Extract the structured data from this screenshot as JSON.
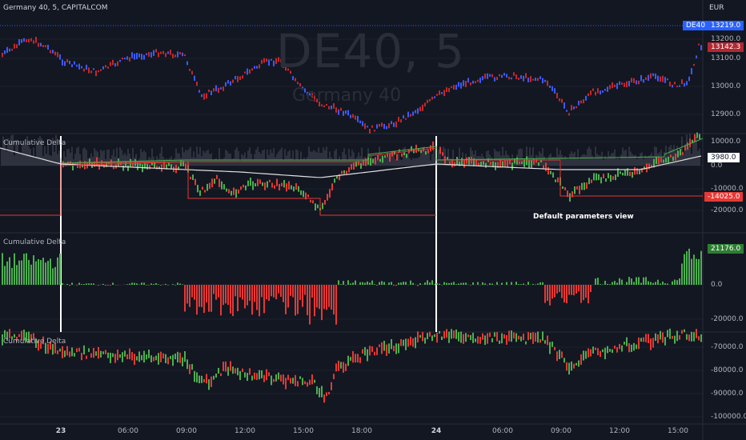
{
  "header": {
    "symbol_title": "Germany 40, 5, CAPITALCOM",
    "currency": "EUR"
  },
  "watermark": {
    "main": "DE40, 5",
    "sub": "Germany 40"
  },
  "price_pane": {
    "ticks": [
      "13200.0",
      "13100.0",
      "13000.0",
      "12900.0"
    ],
    "badge_symbol": "DE40",
    "badge_last": "13219.0",
    "badge_current": "13142.3"
  },
  "delta_pane": {
    "title": "Cumulative Delta",
    "ticks": [
      "10000.0",
      "0.0",
      "-10000.0",
      "-20000.0"
    ],
    "badge_white": "3980.0",
    "badge_red": "-14025.0",
    "annotation": "Default parameters view"
  },
  "histogram_pane": {
    "title": "Cumulative Delta",
    "ticks": [
      "0.0",
      "-20000.0"
    ],
    "badge_green": "21176.0"
  },
  "candle_pane": {
    "title": "Cumulative Delta",
    "ticks": [
      "-70000.0",
      "-80000.0",
      "-90000.0",
      "-100000.0"
    ]
  },
  "time_axis": [
    "23",
    "06:00",
    "09:00",
    "12:00",
    "15:00",
    "18:00",
    "24",
    "06:00",
    "09:00",
    "12:00",
    "15:00"
  ],
  "colors": {
    "background": "#131722",
    "up_candle": "#3d5afe",
    "down_candle": "#c62828",
    "delta_up": "#4caf50",
    "delta_down": "#e53935",
    "badge_blue": "#2962ff",
    "badge_red": "#b22833",
    "badge_green": "#2e7d32"
  }
}
